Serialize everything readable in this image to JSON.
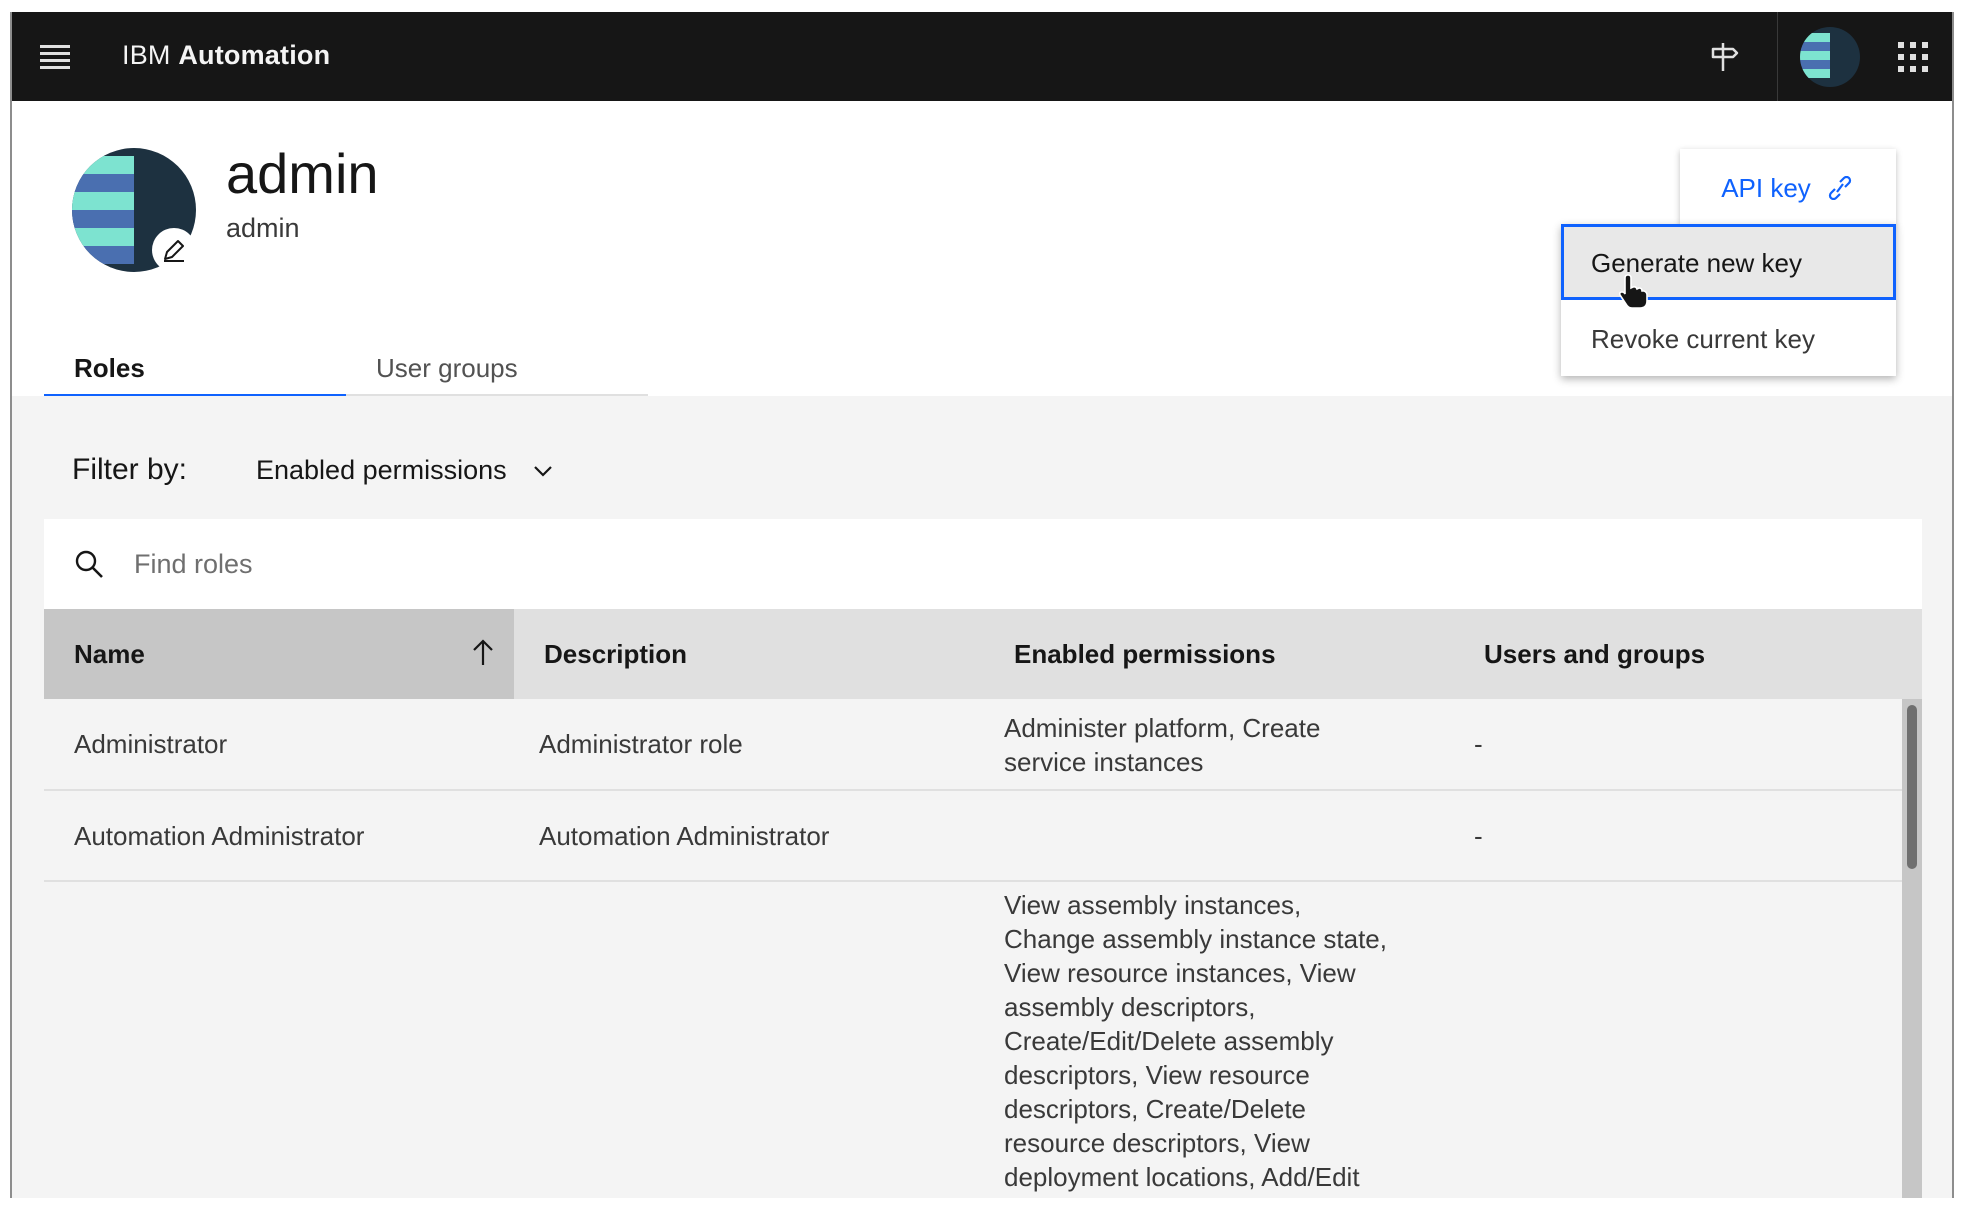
{
  "header": {
    "brand_prefix": "IBM",
    "brand_name": "Automation",
    "menu_icon": "hamburger-menu-icon",
    "icons": [
      "signpost-icon",
      "user-avatar-icon",
      "app-switcher-icon"
    ]
  },
  "profile": {
    "name": "admin",
    "username": "admin",
    "edit_icon": "pencil-icon"
  },
  "tabs": [
    {
      "label": "Roles",
      "active": true
    },
    {
      "label": "User groups",
      "active": false
    }
  ],
  "api_key": {
    "label": "API key",
    "icon": "link-icon",
    "menu": [
      {
        "label": "Generate new key",
        "focused": true
      },
      {
        "label": "Revoke current key",
        "focused": false
      }
    ]
  },
  "filter": {
    "label": "Filter by:",
    "selected": "Enabled permissions"
  },
  "search": {
    "placeholder": "Find roles"
  },
  "table": {
    "columns": [
      "Name",
      "Description",
      "Enabled permissions",
      "Users and groups"
    ],
    "sorted_column": "Name",
    "sort_direction": "ascending",
    "rows": [
      {
        "name": "Administrator",
        "description": "Administrator role",
        "permissions": [
          "Administer platform, Create",
          "service instances"
        ],
        "users": "-"
      },
      {
        "name": "Automation Administrator",
        "description": "Automation Administrator",
        "permissions": [],
        "users": "-"
      },
      {
        "name": "",
        "description": "",
        "permissions": [
          "View assembly instances,",
          "Change assembly instance state,",
          "View resource instances, View",
          "assembly descriptors,",
          "Create/Edit/Delete assembly",
          "descriptors, View resource",
          "descriptors, Create/Delete",
          "resource descriptors, View",
          "deployment locations, Add/Edit"
        ],
        "users": ""
      }
    ]
  },
  "colors": {
    "header_bg": "#161616",
    "accent": "#0f62fe",
    "avatar_dark": "#1d3140",
    "avatar_teal": "#7de3d0",
    "avatar_blue": "#4a6fb0"
  }
}
